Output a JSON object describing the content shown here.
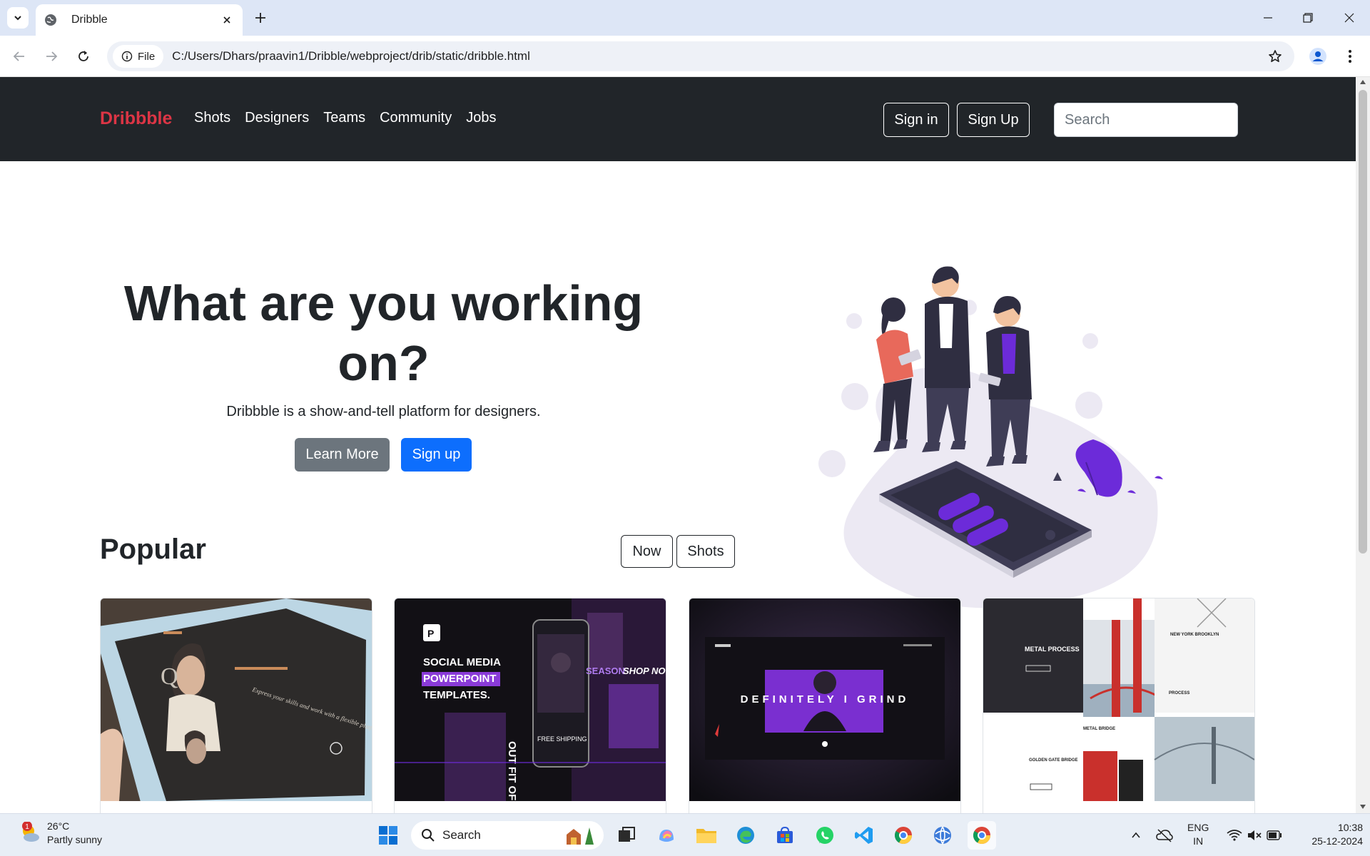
{
  "browser": {
    "tab_title": "Dribble",
    "chip_label": "File",
    "url": "C:/Users/Dhars/praavin1/Dribble/webproject/drib/static/dribble.html"
  },
  "navbar": {
    "brand": "Dribbble",
    "links": [
      "Shots",
      "Designers",
      "Teams",
      "Community",
      "Jobs"
    ],
    "sign_in": "Sign in",
    "sign_up": "Sign Up",
    "search_placeholder": "Search"
  },
  "hero": {
    "title": "What are you working on?",
    "subtitle": "Dribbble is a show-and-tell platform for designers.",
    "learn_more": "Learn More",
    "sign_up": "Sign up"
  },
  "popular": {
    "title": "Popular",
    "filters": [
      "Now",
      "Shots"
    ],
    "shots": [
      {
        "name": "fashion-tablet-shot",
        "caption": "Express your skills and work with a flexible platform"
      },
      {
        "name": "social-media-templates-shot",
        "heading": [
          "SOCIAL MEDIA",
          "POWERPOINT",
          "TEMPLATES."
        ],
        "tags": [
          "SEASON",
          "SHOP NOW",
          "OUT FIT OF THE DAY",
          "FREE SHIPPING"
        ]
      },
      {
        "name": "definitely-i-grind-shot",
        "headline": "DEFINITELY I GRIND"
      },
      {
        "name": "metal-process-shot",
        "labels": [
          "METAL PROCESS",
          "NEW YORK BROOKLYN",
          "PROCESS",
          "METAL BRIDGE",
          "GOLDEN GATE BRIDGE"
        ]
      }
    ]
  },
  "taskbar": {
    "weather_temp": "26°C",
    "weather_desc": "Partly sunny",
    "weather_badge": "1",
    "search_label": "Search",
    "lang_1": "ENG",
    "lang_2": "IN",
    "time": "10:38",
    "date": "25-12-2024"
  },
  "colors": {
    "navbar_bg": "#212529",
    "brand": "#dc3545",
    "primary": "#0d6efd",
    "secondary": "#6c757d",
    "illustration_accent": "#6c2bd9"
  }
}
